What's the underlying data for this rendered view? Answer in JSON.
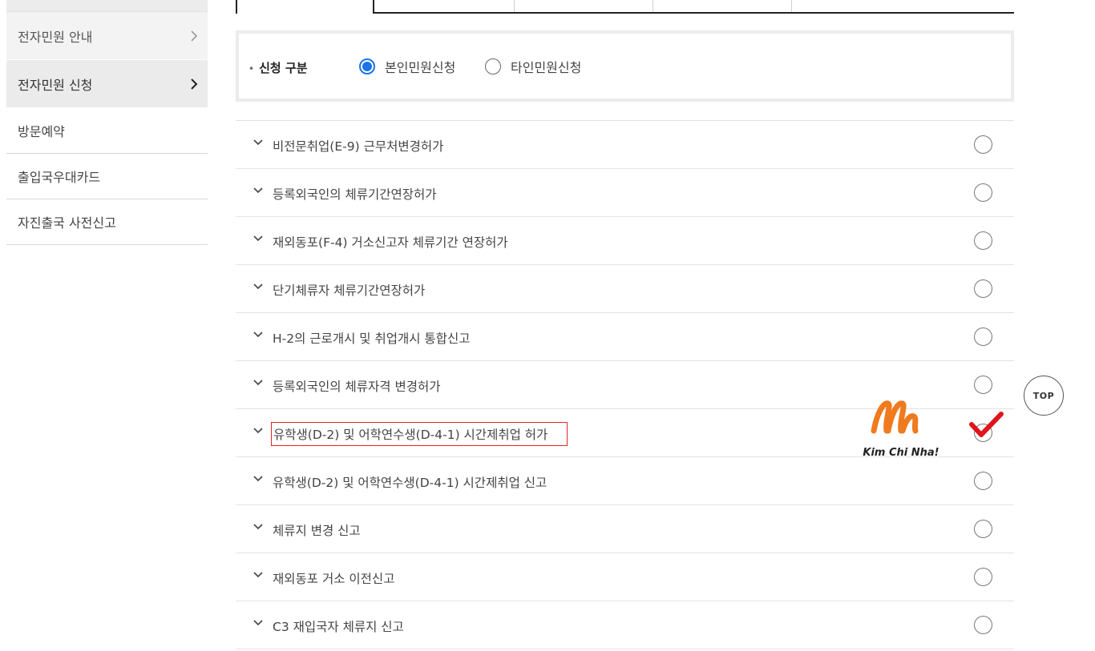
{
  "sidebar": {
    "items": [
      {
        "label": "전자민원 안내"
      },
      {
        "label": "전자민원 신청"
      },
      {
        "label": "방문예약"
      },
      {
        "label": "출입국우대카드"
      },
      {
        "label": "자진출국 사전신고"
      }
    ]
  },
  "apply_type": {
    "label": "신청 구분",
    "options": [
      {
        "label": "본인민원신청",
        "selected": true
      },
      {
        "label": "타인민원신청",
        "selected": false
      }
    ]
  },
  "petitions": [
    {
      "title": "비전문취업(E-9) 근무처변경허가"
    },
    {
      "title": "등록외국인의 체류기간연장허가"
    },
    {
      "title": "재외동포(F-4) 거소신고자 체류기간 연장허가"
    },
    {
      "title": "단기체류자 체류기간연장허가"
    },
    {
      "title": "H-2의 근로개시 및 취업개시 통합신고"
    },
    {
      "title": "등록외국인의 체류자격 변경허가"
    },
    {
      "title": "유학생(D-2) 및 어학연수생(D-4-1) 시간제취업 허가",
      "highlighted": true
    },
    {
      "title": "유학생(D-2) 및 어학연수생(D-4-1) 시간제취업 신고"
    },
    {
      "title": "체류지 변경 신고"
    },
    {
      "title": "재외동포 거소 이전신고"
    },
    {
      "title": "C3 재입국자 체류지 신고"
    }
  ],
  "top_button": {
    "label": "TOP"
  },
  "watermark": {
    "text": "Kim Chi Nha!"
  },
  "colors": {
    "radio_selected": "#1a73e8",
    "highlight_border": "#e0262a",
    "check_mark": "#e0151b",
    "logo_orange": "#f07a1e"
  }
}
